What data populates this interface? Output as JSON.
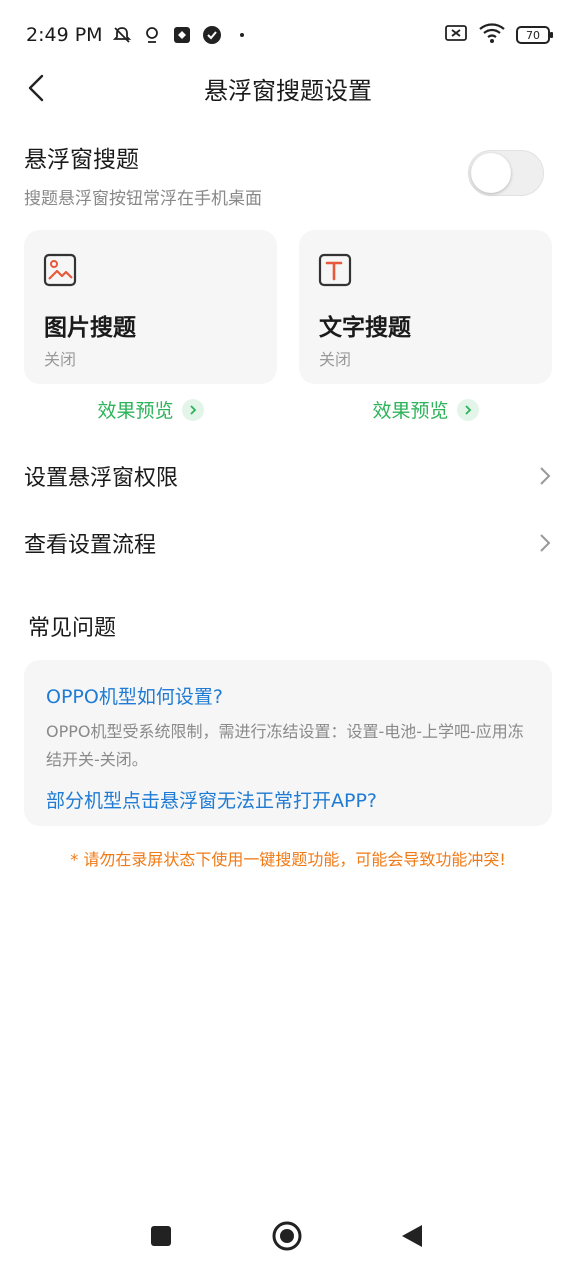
{
  "status_bar": {
    "time": "2:49 PM",
    "battery": "70",
    "icons": [
      "bell-off-icon",
      "location-icon",
      "app-icon",
      "check-circle-icon",
      "dot-icon",
      "sim-off-icon",
      "wifi-icon",
      "battery-icon"
    ]
  },
  "header": {
    "title": "悬浮窗搜题设置",
    "back_icon": "back-chevron-icon"
  },
  "floating_toggle": {
    "title": "悬浮窗搜题",
    "description": "搜题悬浮窗按钮常浮在手机桌面",
    "enabled": false
  },
  "cards": [
    {
      "title": "图片搜题",
      "status": "关闭",
      "icon": "image-icon",
      "preview": "效果预览"
    },
    {
      "title": "文字搜题",
      "status": "关闭",
      "icon": "text-icon",
      "preview": "效果预览"
    }
  ],
  "nav_rows": [
    {
      "label": "设置悬浮窗权限"
    },
    {
      "label": "查看设置流程"
    }
  ],
  "faq": {
    "heading": "常见问题",
    "items": [
      {
        "question": "OPPO机型如何设置?",
        "answer": "OPPO机型受系统限制，需进行冻结设置：设置-电池-上学吧-应用冻结开关-关闭。"
      },
      {
        "question": "部分机型点击悬浮窗无法正常打开APP?"
      }
    ]
  },
  "warning": "* 请勿在录屏状态下使用一键搜题功能，可能会导致功能冲突!",
  "colors": {
    "accent_green": "#2db35a",
    "link_blue": "#1f7bd4",
    "warning_orange": "#f07a16",
    "icon_red": "#e8593b"
  }
}
